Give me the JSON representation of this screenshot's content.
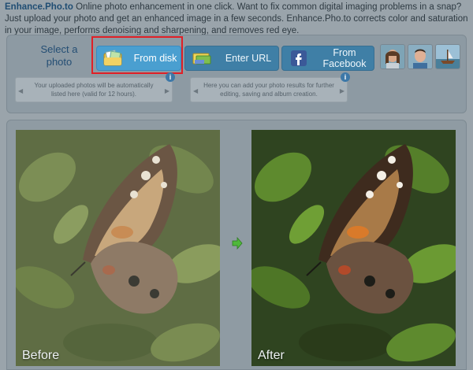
{
  "intro": {
    "brand": "Enhance.Pho.to",
    "text": " Online photo enhancement in one click. Want to fix common digital imaging problems in a snap? Just upload your photo and get an enhanced image in a few seconds. Enhance.Pho.to corrects color and saturation in your image, performs denoising and sharpening, and removes red eye."
  },
  "upload": {
    "select_label": "Select a photo",
    "buttons": {
      "from_disk": "From disk",
      "enter_url": "Enter URL",
      "from_facebook": "From Facebook"
    },
    "info_left": "Your uploaded photos will be automatically listed here (valid for 12 hours).",
    "info_right": "Here you can add your photo results for further editing, saving and album creation.",
    "info_badge": "i"
  },
  "result": {
    "before_label": "Before",
    "after_label": "After"
  },
  "colors": {
    "highlight": "#e01f26",
    "active_button": "#4a9fd0",
    "button": "#3f7fa6"
  }
}
